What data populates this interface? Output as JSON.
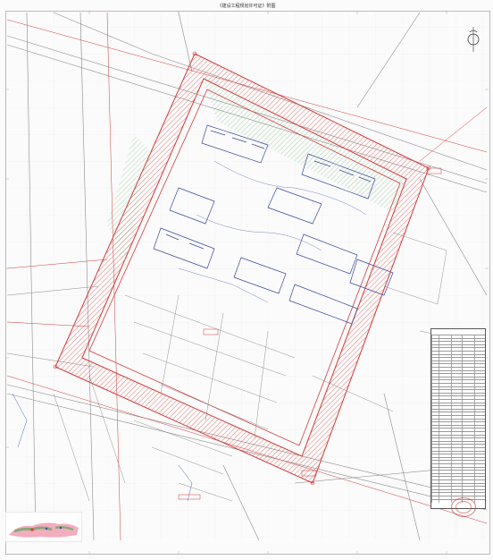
{
  "document": {
    "title": "《建设工程规划许可证》附图"
  },
  "colors": {
    "boundary_red": "#d23a3a",
    "hatch_red": "#e05555",
    "building_blue": "#3a4a9a",
    "green_zone": "#6cae6c",
    "road_line": "#8a8a8a",
    "inset_pink": "#e86a8a",
    "inset_green": "#5aa85a"
  },
  "icons": {
    "logo": "compass-logo-icon",
    "seal": "red-approval-seal-icon"
  }
}
